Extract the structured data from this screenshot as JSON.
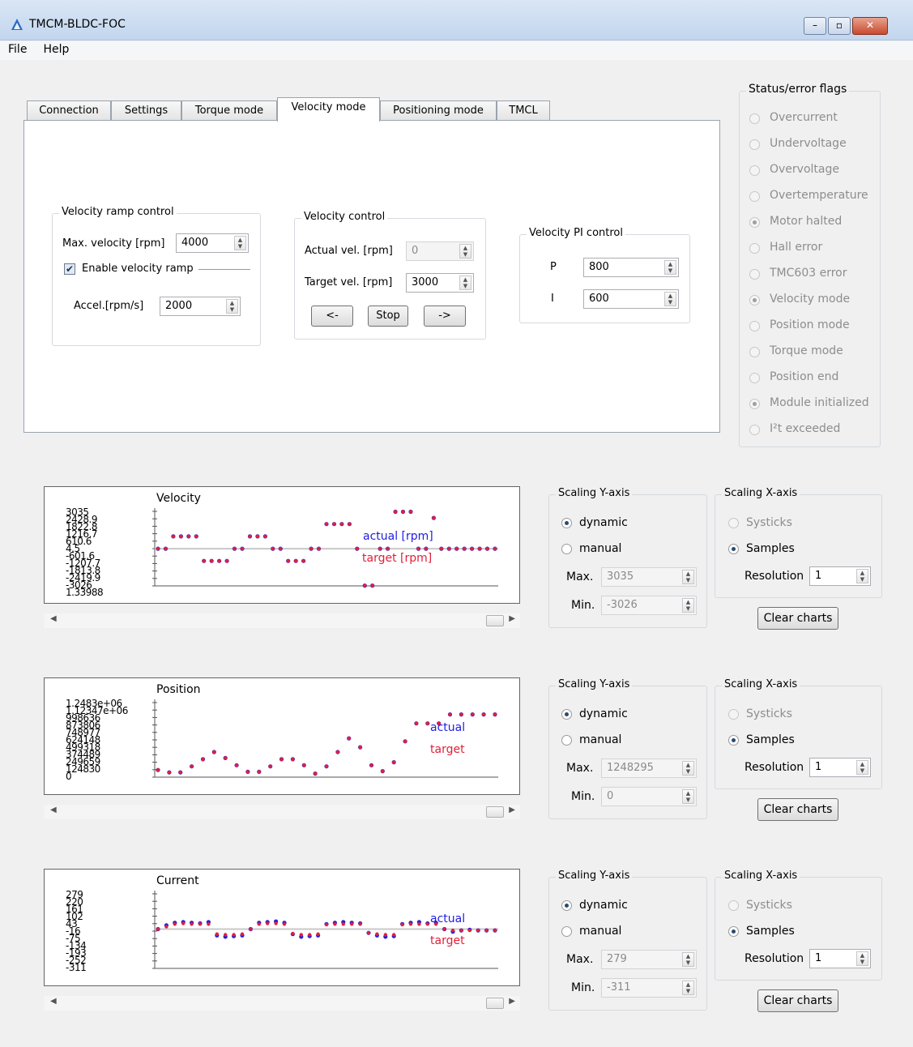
{
  "window": {
    "title": "TMCM-BLDC-FOC",
    "min_label": "–",
    "max_label": "▫",
    "close_label": "✕"
  },
  "menu": {
    "file": "File",
    "help": "Help"
  },
  "tabs": [
    "Connection",
    "Settings",
    "Torque mode",
    "Velocity mode",
    "Positioning mode",
    "TMCL"
  ],
  "active_tab": "Velocity mode",
  "ramp": {
    "title": "Velocity ramp control",
    "max_vel_label": "Max. velocity [rpm]",
    "max_vel_value": "4000",
    "enable_label": "Enable velocity ramp",
    "enable_checked": true,
    "accel_label": "Accel.[rpm/s]",
    "accel_value": "2000"
  },
  "vel_control": {
    "title": "Velocity control",
    "actual_label": "Actual vel. [rpm]",
    "actual_value": "0",
    "target_label": "Target vel. [rpm]",
    "target_value": "3000",
    "left_btn": "<-",
    "stop_btn": "Stop",
    "right_btn": "->"
  },
  "pi": {
    "title": "Velocity PI control",
    "p_label": "P",
    "p_value": "800",
    "i_label": "I",
    "i_value": "600"
  },
  "status": {
    "title": "Status/error flags",
    "flags": [
      {
        "label": "Overcurrent",
        "on": false
      },
      {
        "label": "Undervoltage",
        "on": false
      },
      {
        "label": "Overvoltage",
        "on": false
      },
      {
        "label": "Overtemperature",
        "on": false
      },
      {
        "label": "Motor halted",
        "on": true
      },
      {
        "label": "Hall error",
        "on": false
      },
      {
        "label": "TMC603 error",
        "on": false
      },
      {
        "label": "Velocity mode",
        "on": true
      },
      {
        "label": "Position mode",
        "on": false
      },
      {
        "label": "Torque mode",
        "on": false
      },
      {
        "label": "Position end",
        "on": false
      },
      {
        "label": "Module initialized",
        "on": true
      },
      {
        "label": "I²t exceeded",
        "on": false
      }
    ]
  },
  "colors": {
    "actual": "#2020e0",
    "target": "#e0203a",
    "zero_line": "#c8c8c8"
  },
  "panels": [
    {
      "chart_title": "Velocity",
      "legend_actual": "actual [rpm]",
      "legend_target": "target [rpm]",
      "yticks": [
        "3035",
        "2428.9",
        "1822.8",
        "1216.7",
        "610.6",
        "4.5",
        "-601.6",
        "-1207.7",
        "-1813.8",
        "-2419.9",
        "-3026",
        "1.33988"
      ],
      "scaling_y": "Scaling Y-axis",
      "dynamic": "dynamic",
      "manual": "manual",
      "mode": "dynamic",
      "max_label": "Max.",
      "max_value": "3035",
      "min_label": "Min.",
      "min_value": "-3026",
      "scaling_x": "Scaling X-axis",
      "systicks": "Systicks",
      "samples": "Samples",
      "resolution_label": "Resolution",
      "resolution_value": "1",
      "clear": "Clear charts"
    },
    {
      "chart_title": "Position",
      "legend_actual": "actual",
      "legend_target": "target",
      "yticks": [
        "1.2483e+06",
        "1.12347e+06",
        "998636",
        "873806",
        "748977",
        "624148",
        "499318",
        "374489",
        "249659",
        "124830",
        "0"
      ],
      "scaling_y": "Scaling Y-axis",
      "dynamic": "dynamic",
      "manual": "manual",
      "mode": "dynamic",
      "max_label": "Max.",
      "max_value": "1248295",
      "min_label": "Min.",
      "min_value": "0",
      "scaling_x": "Scaling X-axis",
      "systicks": "Systicks",
      "samples": "Samples",
      "resolution_label": "Resolution",
      "resolution_value": "1",
      "clear": "Clear charts"
    },
    {
      "chart_title": "Current",
      "legend_actual": "actual",
      "legend_target": "target",
      "yticks": [
        "279",
        "220",
        "161",
        "102",
        "43",
        "-16",
        "-75",
        "-134",
        "-193",
        "-252",
        "-311"
      ],
      "scaling_y": "Scaling Y-axis",
      "dynamic": "dynamic",
      "manual": "manual",
      "mode": "dynamic",
      "max_label": "Max.",
      "max_value": "279",
      "min_label": "Min.",
      "min_value": "-311",
      "scaling_x": "Scaling X-axis",
      "systicks": "Systicks",
      "samples": "Samples",
      "resolution_label": "Resolution",
      "resolution_value": "1",
      "clear": "Clear charts"
    }
  ],
  "chart_data": [
    {
      "type": "line",
      "title": "Velocity",
      "ylim": [
        -3026,
        3035
      ],
      "series": [
        {
          "name": "actual [rpm]",
          "values": [
            0,
            0,
            1000,
            1000,
            1000,
            1000,
            -1000,
            -1000,
            -1000,
            -1000,
            0,
            0,
            1000,
            1000,
            1000,
            0,
            0,
            -1000,
            -1000,
            -1000,
            0,
            0,
            2000,
            2000,
            2000,
            2000,
            0,
            -3000,
            -3000,
            0,
            0,
            3000,
            3000,
            3000,
            0,
            0,
            2500,
            0,
            0,
            0,
            0,
            0,
            0,
            0,
            0
          ]
        },
        {
          "name": "target [rpm]",
          "values": [
            0,
            0,
            1000,
            1000,
            1000,
            1000,
            -1000,
            -1000,
            -1000,
            -1000,
            0,
            0,
            1000,
            1000,
            1000,
            0,
            0,
            -1000,
            -1000,
            -1000,
            0,
            0,
            2000,
            2000,
            2000,
            2000,
            0,
            -3000,
            -3000,
            0,
            0,
            3000,
            3000,
            3000,
            0,
            0,
            2500,
            0,
            0,
            0,
            0,
            0,
            0,
            0,
            0
          ]
        }
      ]
    },
    {
      "type": "line",
      "title": "Position",
      "ylim": [
        0,
        1248295
      ],
      "series": [
        {
          "name": "actual",
          "values": [
            120000,
            80000,
            80000,
            180000,
            300000,
            420000,
            320000,
            200000,
            90000,
            90000,
            180000,
            300000,
            300000,
            200000,
            60000,
            180000,
            420000,
            650000,
            500000,
            200000,
            100000,
            250000,
            600000,
            900000,
            900000,
            900000,
            1050000,
            1050000,
            1050000,
            1050000,
            1050000
          ]
        },
        {
          "name": "target",
          "values": [
            120000,
            80000,
            80000,
            180000,
            300000,
            420000,
            320000,
            200000,
            90000,
            90000,
            180000,
            300000,
            300000,
            200000,
            60000,
            180000,
            420000,
            650000,
            500000,
            200000,
            100000,
            250000,
            600000,
            900000,
            900000,
            900000,
            1050000,
            1050000,
            1050000,
            1050000,
            1050000
          ]
        }
      ]
    },
    {
      "type": "scatter",
      "title": "Current",
      "ylim": [
        -311,
        279
      ],
      "series": [
        {
          "name": "actual",
          "values": [
            0,
            30,
            50,
            55,
            50,
            45,
            55,
            -50,
            -60,
            -55,
            -50,
            0,
            50,
            55,
            60,
            50,
            -40,
            -60,
            -55,
            -50,
            40,
            50,
            55,
            50,
            45,
            -30,
            -50,
            -60,
            -55,
            40,
            50,
            55,
            45,
            50,
            0,
            -20,
            -10,
            -5,
            -10,
            -10,
            -10
          ]
        },
        {
          "name": "target",
          "values": [
            0,
            20,
            40,
            45,
            40,
            40,
            40,
            -40,
            -45,
            -45,
            -40,
            0,
            40,
            45,
            45,
            40,
            -35,
            -45,
            -45,
            -40,
            35,
            40,
            40,
            40,
            40,
            -30,
            -40,
            -45,
            -45,
            35,
            40,
            40,
            40,
            40,
            0,
            -10,
            -10,
            -10,
            -10,
            -10,
            -10
          ]
        }
      ]
    }
  ]
}
